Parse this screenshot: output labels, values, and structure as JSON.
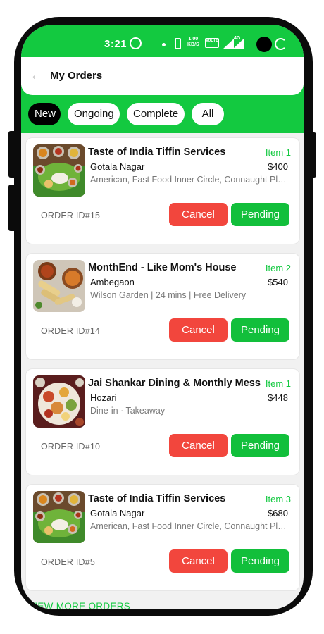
{
  "status_bar": {
    "time": "3:21",
    "net_speed_top": "1.00",
    "net_speed_bottom": "KB/S",
    "volte_label": "VoLTE",
    "network_type": "4G"
  },
  "header": {
    "title": "My Orders"
  },
  "tabs": [
    {
      "label": "New",
      "active": true
    },
    {
      "label": "Ongoing",
      "active": false
    },
    {
      "label": "Complete",
      "active": false
    },
    {
      "label": "All",
      "active": false
    }
  ],
  "orders": [
    {
      "name": "Taste of India Tiffin Services",
      "item_count": "Item 1",
      "location": "Gotala Nagar",
      "price": "$400",
      "description": "American, Fast Food Inner Circle, Connaught Place",
      "order_id": "ORDER ID#15",
      "cancel_label": "Cancel",
      "status_label": "Pending"
    },
    {
      "name": "MonthEnd - Like Mom's House",
      "item_count": "Item 2",
      "location": "Ambegaon",
      "price": "$540",
      "description": "Wilson Garden | 24 mins | Free Delivery",
      "order_id": "ORDER ID#14",
      "cancel_label": "Cancel",
      "status_label": "Pending"
    },
    {
      "name": "Jai Shankar Dining & Monthly Mess",
      "item_count": "Item 1",
      "location": "Hozari",
      "price": "$448",
      "description": "Dine-in · Takeaway",
      "order_id": "ORDER ID#10",
      "cancel_label": "Cancel",
      "status_label": "Pending"
    },
    {
      "name": "Taste of India Tiffin Services",
      "item_count": "Item 3",
      "location": "Gotala Nagar",
      "price": "$680",
      "description": "American, Fast Food Inner Circle, Connaught Place",
      "order_id": "ORDER ID#5",
      "cancel_label": "Cancel",
      "status_label": "Pending"
    }
  ],
  "footer": {
    "view_more": "VIEW MORE ORDERS"
  },
  "colors": {
    "brand_green": "#13c940",
    "cancel_red": "#f2463d",
    "pending_green": "#12bf3b"
  }
}
